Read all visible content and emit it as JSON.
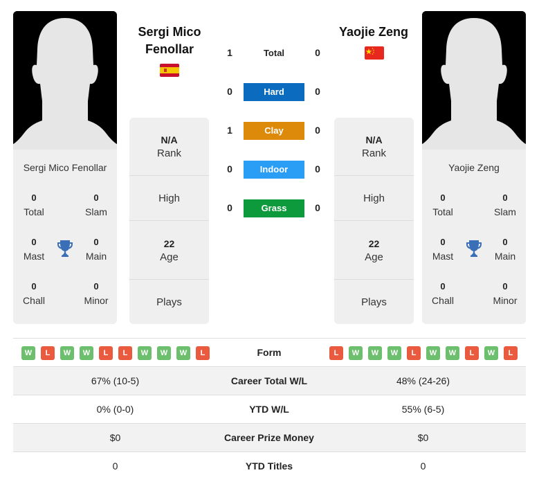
{
  "players": {
    "left": {
      "name": "Sergi Mico Fenollar",
      "title_line1": "Sergi Mico",
      "title_line2": "Fenollar",
      "country": "Spain",
      "flag_icon": "spain-flag-icon",
      "titles": {
        "total": {
          "value": "0",
          "label": "Total"
        },
        "slam": {
          "value": "0",
          "label": "Slam"
        },
        "mast": {
          "value": "0",
          "label": "Mast"
        },
        "main": {
          "value": "0",
          "label": "Main"
        },
        "chall": {
          "value": "0",
          "label": "Chall"
        },
        "minor": {
          "value": "0",
          "label": "Minor"
        }
      },
      "rank": {
        "value": "N/A",
        "label": "Rank"
      },
      "high": {
        "label": "High"
      },
      "age": {
        "value": "22",
        "label": "Age"
      },
      "plays": {
        "label": "Plays"
      }
    },
    "right": {
      "name": "Yaojie Zeng",
      "title_line1": "Yaojie Zeng",
      "country": "China",
      "flag_icon": "china-flag-icon",
      "titles": {
        "total": {
          "value": "0",
          "label": "Total"
        },
        "slam": {
          "value": "0",
          "label": "Slam"
        },
        "mast": {
          "value": "0",
          "label": "Mast"
        },
        "main": {
          "value": "0",
          "label": "Main"
        },
        "chall": {
          "value": "0",
          "label": "Chall"
        },
        "minor": {
          "value": "0",
          "label": "Minor"
        }
      },
      "rank": {
        "value": "N/A",
        "label": "Rank"
      },
      "high": {
        "label": "High"
      },
      "age": {
        "value": "22",
        "label": "Age"
      },
      "plays": {
        "label": "Plays"
      }
    }
  },
  "h2h": [
    {
      "label": "Total",
      "left": "1",
      "right": "0",
      "color": null
    },
    {
      "label": "Hard",
      "left": "0",
      "right": "0",
      "color": "#0a6bbf"
    },
    {
      "label": "Clay",
      "left": "1",
      "right": "0",
      "color": "#dd8a0a"
    },
    {
      "label": "Indoor",
      "left": "0",
      "right": "0",
      "color": "#2a9df4"
    },
    {
      "label": "Grass",
      "left": "0",
      "right": "0",
      "color": "#0c9a3c"
    }
  ],
  "form": {
    "label": "Form",
    "left": [
      "W",
      "L",
      "W",
      "W",
      "L",
      "L",
      "W",
      "W",
      "W",
      "L"
    ],
    "right": [
      "L",
      "W",
      "W",
      "W",
      "L",
      "W",
      "W",
      "L",
      "W",
      "L"
    ]
  },
  "stats": [
    {
      "label": "Career Total W/L",
      "left": "67% (10-5)",
      "right": "48% (24-26)"
    },
    {
      "label": "YTD W/L",
      "left": "0% (0-0)",
      "right": "55% (6-5)"
    },
    {
      "label": "Career Prize Money",
      "left": "$0",
      "right": "$0"
    },
    {
      "label": "YTD Titles",
      "left": "0",
      "right": "0"
    }
  ],
  "colors": {
    "win": "#6cbf6c",
    "loss": "#ea5a3f",
    "trophy": "#3a6fb8",
    "card_bg": "#efefef"
  }
}
